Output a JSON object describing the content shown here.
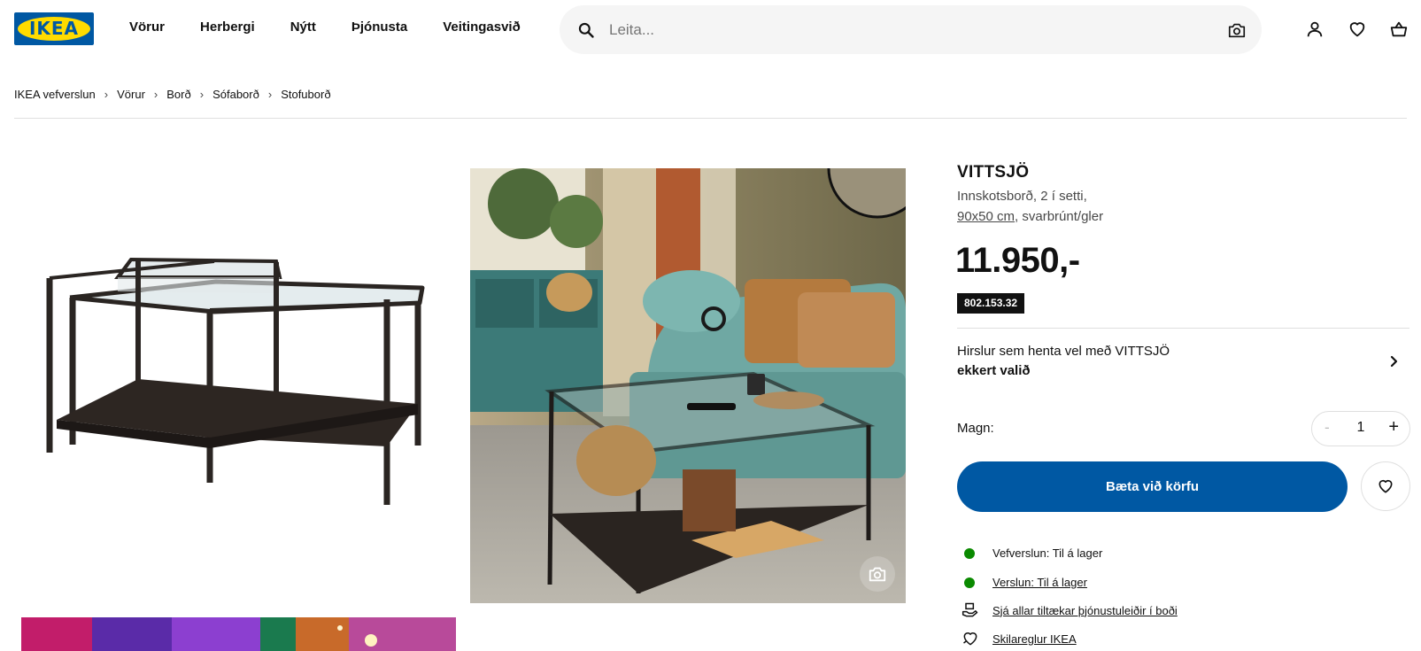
{
  "header": {
    "logo_text": "IKEA",
    "nav": [
      "Vörur",
      "Herbergi",
      "Nýtt",
      "Þjónusta",
      "Veitingasvið"
    ],
    "search_placeholder": "Leita...",
    "icons": [
      "search-icon",
      "camera-icon",
      "user-icon",
      "heart-icon",
      "basket-icon"
    ]
  },
  "breadcrumb": [
    "IKEA vefverslun",
    "Vörur",
    "Borð",
    "Sófaborð",
    "Stofuborð"
  ],
  "product": {
    "name": "VITTSJÖ",
    "desc_line1": "Innskotsborð, 2 í setti,",
    "size_link": "90x50 cm",
    "desc_suffix": ", svarbrúnt/gler",
    "price": "11.950,-",
    "article_number": "802.153.32"
  },
  "storage": {
    "label": "Hirslur sem henta vel með VITTSJÖ",
    "value": "ekkert valið"
  },
  "quantity": {
    "label": "Magn:",
    "minus": "-",
    "value": "1",
    "plus": "+"
  },
  "add_to_cart_label": "Bæta við körfu",
  "availability": {
    "online": "Vefverslun: Til á lager",
    "store": "Verslun: Til á lager",
    "services": "Sjá allar tiltækar þjónustuleiðir í boði",
    "returns": "Skilareglur IKEA"
  },
  "colors": {
    "brand_blue": "#0058a3",
    "brand_yellow": "#ffdb00",
    "in_stock_green": "#0a8a00"
  }
}
